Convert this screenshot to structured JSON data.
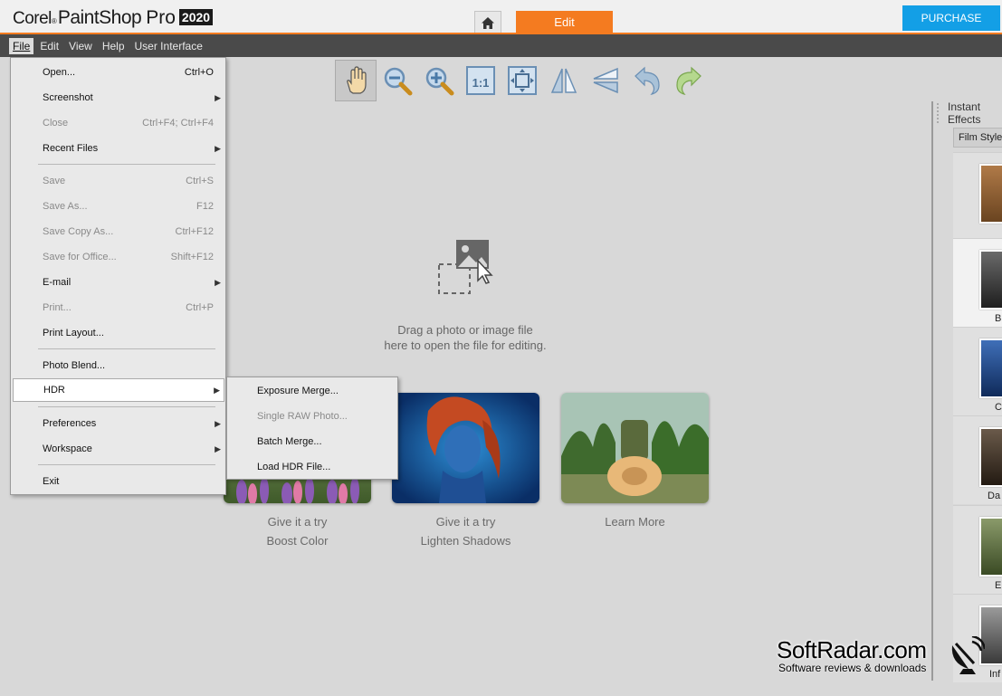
{
  "app": {
    "brand_corel": "Corel",
    "brand_reg": "®",
    "brand_paintshop": "PaintShop",
    "brand_pro": "Pro",
    "brand_year": "2020",
    "edit_tab": "Edit",
    "purchase": "PURCHASE"
  },
  "menubar": {
    "file": "File",
    "edit": "Edit",
    "view": "View",
    "help": "Help",
    "user_interface": "User Interface"
  },
  "toolbar": {
    "icons": [
      "pan-icon",
      "zoom-out-icon",
      "zoom-in-icon",
      "actual-size-icon",
      "fit-to-window-icon",
      "flip-icon",
      "mirror-icon",
      "undo-icon",
      "redo-icon"
    ]
  },
  "workspace": {
    "drop_line1": "Drag a photo or image file",
    "drop_line2": "here to open the file for editing.",
    "cards": [
      {
        "line1": "Give it a try",
        "line2": "Boost Color"
      },
      {
        "line1": "Give it a try",
        "line2": "Lighten Shadows"
      },
      {
        "line1": "Learn More",
        "line2": ""
      }
    ]
  },
  "right_panel": {
    "header": "Instant Effects",
    "dropdown_value": "Film Styles",
    "thumbs": [
      {
        "label": ""
      },
      {
        "label": "B"
      },
      {
        "label": "C"
      },
      {
        "label": "Da"
      },
      {
        "label": "E"
      },
      {
        "label": "Inf"
      }
    ]
  },
  "file_menu": {
    "items": [
      {
        "label": "Open...",
        "shortcut": "Ctrl+O"
      },
      {
        "label": "Screenshot",
        "shortcut": ""
      },
      {
        "label": "Close",
        "shortcut": "Ctrl+F4; Ctrl+F4"
      },
      {
        "label": "Recent Files",
        "shortcut": ""
      },
      {
        "label": "Save",
        "shortcut": "Ctrl+S"
      },
      {
        "label": "Save As...",
        "shortcut": "F12"
      },
      {
        "label": "Save Copy As...",
        "shortcut": "Ctrl+F12"
      },
      {
        "label": "Save for Office...",
        "shortcut": "Shift+F12"
      },
      {
        "label": "E-mail",
        "shortcut": ""
      },
      {
        "label": "Print...",
        "shortcut": "Ctrl+P"
      },
      {
        "label": "Print Layout...",
        "shortcut": ""
      },
      {
        "label": "Photo Blend...",
        "shortcut": ""
      },
      {
        "label": "HDR",
        "shortcut": ""
      },
      {
        "label": "Preferences",
        "shortcut": ""
      },
      {
        "label": "Workspace",
        "shortcut": ""
      },
      {
        "label": "Exit",
        "shortcut": ""
      }
    ]
  },
  "hdr_menu": {
    "items": [
      {
        "label": "Exposure Merge..."
      },
      {
        "label": "Single RAW Photo..."
      },
      {
        "label": "Batch Merge..."
      },
      {
        "label": "Load HDR File..."
      }
    ]
  },
  "watermark": {
    "title": "SoftRadar.com",
    "subtitle": "Software reviews & downloads"
  },
  "colors": {
    "accent_orange": "#f47b20",
    "purchase_blue": "#139fe6",
    "menubar_bg": "#4a4a4a"
  }
}
